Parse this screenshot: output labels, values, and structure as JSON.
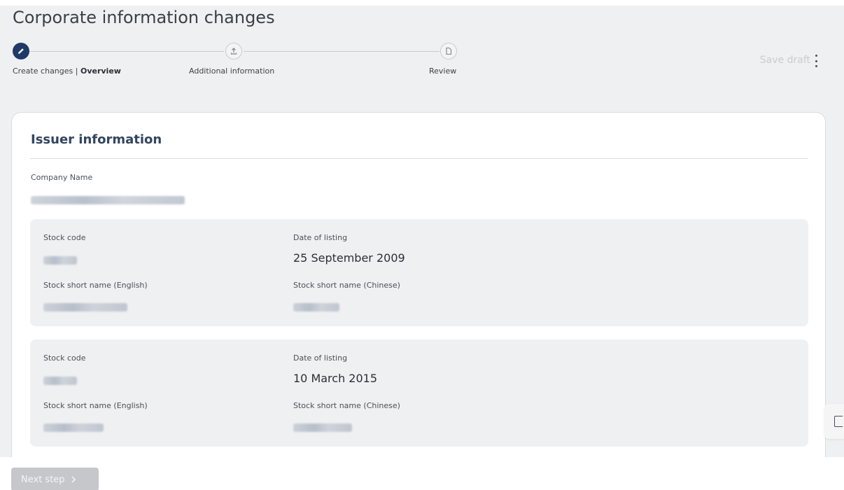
{
  "page": {
    "title": "Corporate information changes"
  },
  "stepper": {
    "steps": [
      {
        "label_prefix": "Create changes | ",
        "label_bold": "Overview",
        "state": "active",
        "icon": "pencil-icon"
      },
      {
        "label": "Additional information",
        "state": "inactive",
        "icon": "upload-icon"
      },
      {
        "label": "Review",
        "state": "inactive",
        "icon": "document-icon"
      }
    ]
  },
  "toolbar": {
    "save_draft": "Save draft",
    "more_icon": "more-vertical-icon"
  },
  "issuer": {
    "section_title": "Issuer information",
    "company_name_label": "Company Name",
    "stocks": [
      {
        "stock_code_label": "Stock code",
        "date_label": "Date of listing",
        "date_value": "25 September 2009",
        "short_en_label": "Stock short name (English)",
        "short_cn_label": "Stock short name (Chinese)"
      },
      {
        "stock_code_label": "Stock code",
        "date_label": "Date of listing",
        "date_value": "10 March 2015",
        "short_en_label": "Stock short name (English)",
        "short_cn_label": "Stock short name (Chinese)"
      }
    ]
  },
  "footer": {
    "next_step": "Next step",
    "next_icon": "chevron-right-icon"
  },
  "colors": {
    "accent": "#1f3a68",
    "header_bg": "#eff0f1",
    "section_title": "#32455f",
    "disabled_button": "#c5c7ca"
  }
}
